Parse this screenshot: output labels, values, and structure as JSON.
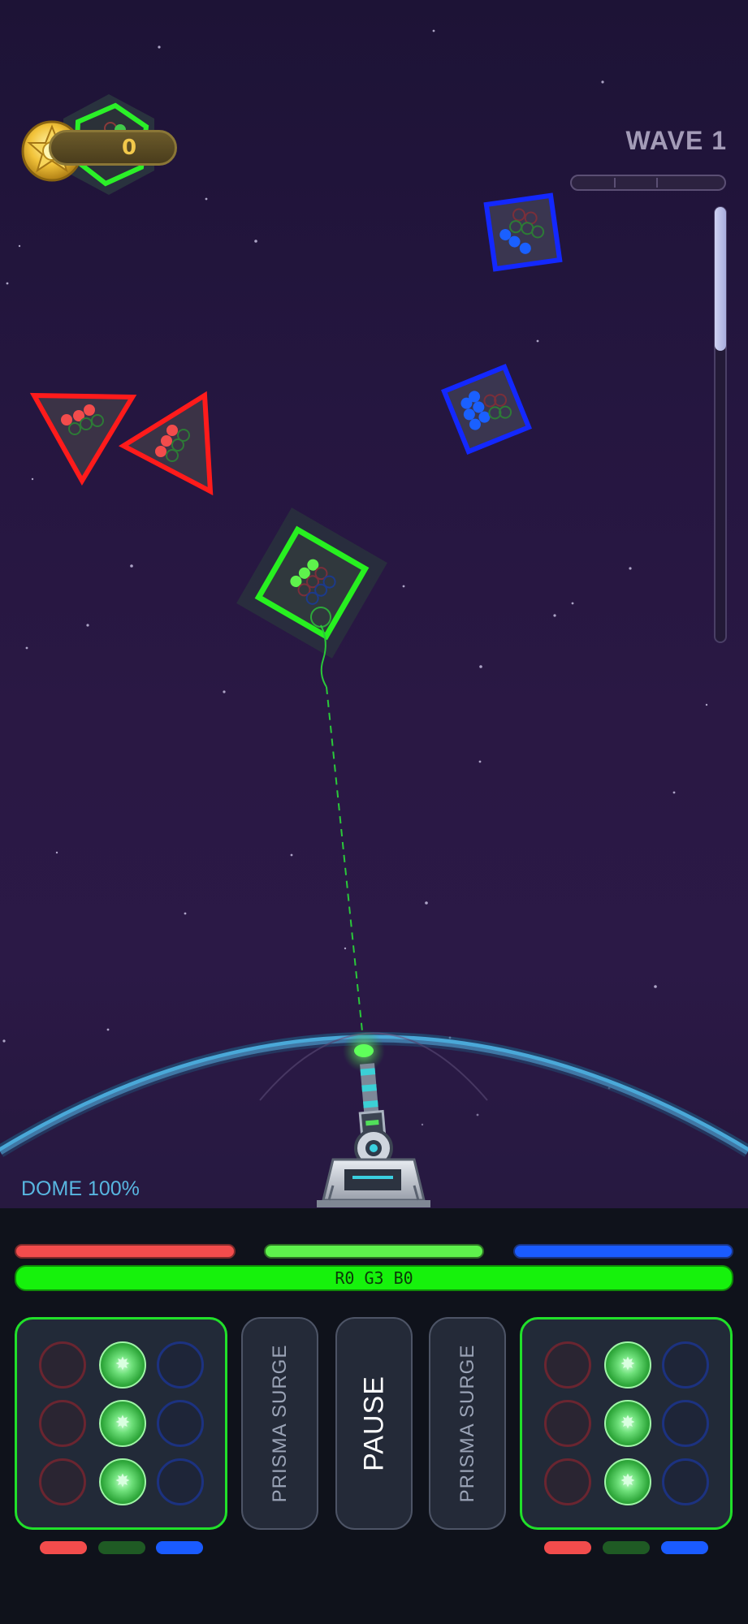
{
  "hud": {
    "coins": "0",
    "wave_label": "WAVE 1",
    "wave_progress": 0.0,
    "side_meter_level": 0.33,
    "dome_label": "DOME 100%"
  },
  "status": {
    "color_counts": "R0 G3 B0",
    "color_red": "#f24c4c",
    "color_green": "#5ef24c",
    "color_blue": "#1a5bff"
  },
  "buttons": {
    "left_surge": "PRISMA SURGE",
    "pause": "PAUSE",
    "right_surge": "PRISMA SURGE"
  },
  "loadouts": {
    "left": {
      "red": 0,
      "green": 3,
      "blue": 0
    },
    "right": {
      "red": 0,
      "green": 3,
      "blue": 0
    }
  },
  "icons": [
    "coin-icon",
    "turret-icon",
    "gem-icon"
  ]
}
